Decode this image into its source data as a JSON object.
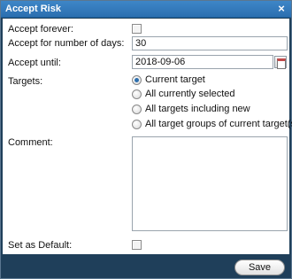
{
  "dialog": {
    "title": "Accept Risk",
    "close_icon": "close-icon"
  },
  "form": {
    "accept_forever_label": "Accept forever:",
    "accept_forever_checked": false,
    "accept_days_label": "Accept for number of days:",
    "accept_days_value": "30",
    "accept_until_label": "Accept until:",
    "accept_until_value": "2018-09-06",
    "calendar_icon": "calendar-icon",
    "targets_label": "Targets:",
    "targets_options": [
      {
        "label": "Current target",
        "checked": true
      },
      {
        "label": "All currently selected",
        "checked": false
      },
      {
        "label": "All targets including new",
        "checked": false
      },
      {
        "label": "All target groups of current target(s)",
        "checked": false
      }
    ],
    "comment_label": "Comment:",
    "comment_value": "",
    "set_default_label": "Set as Default:",
    "set_default_checked": false
  },
  "footer": {
    "save_label": "Save"
  },
  "colors": {
    "titlebar": "#2f76b8",
    "frame": "#1f3f5a",
    "radio_selected": "#2e6fae"
  }
}
